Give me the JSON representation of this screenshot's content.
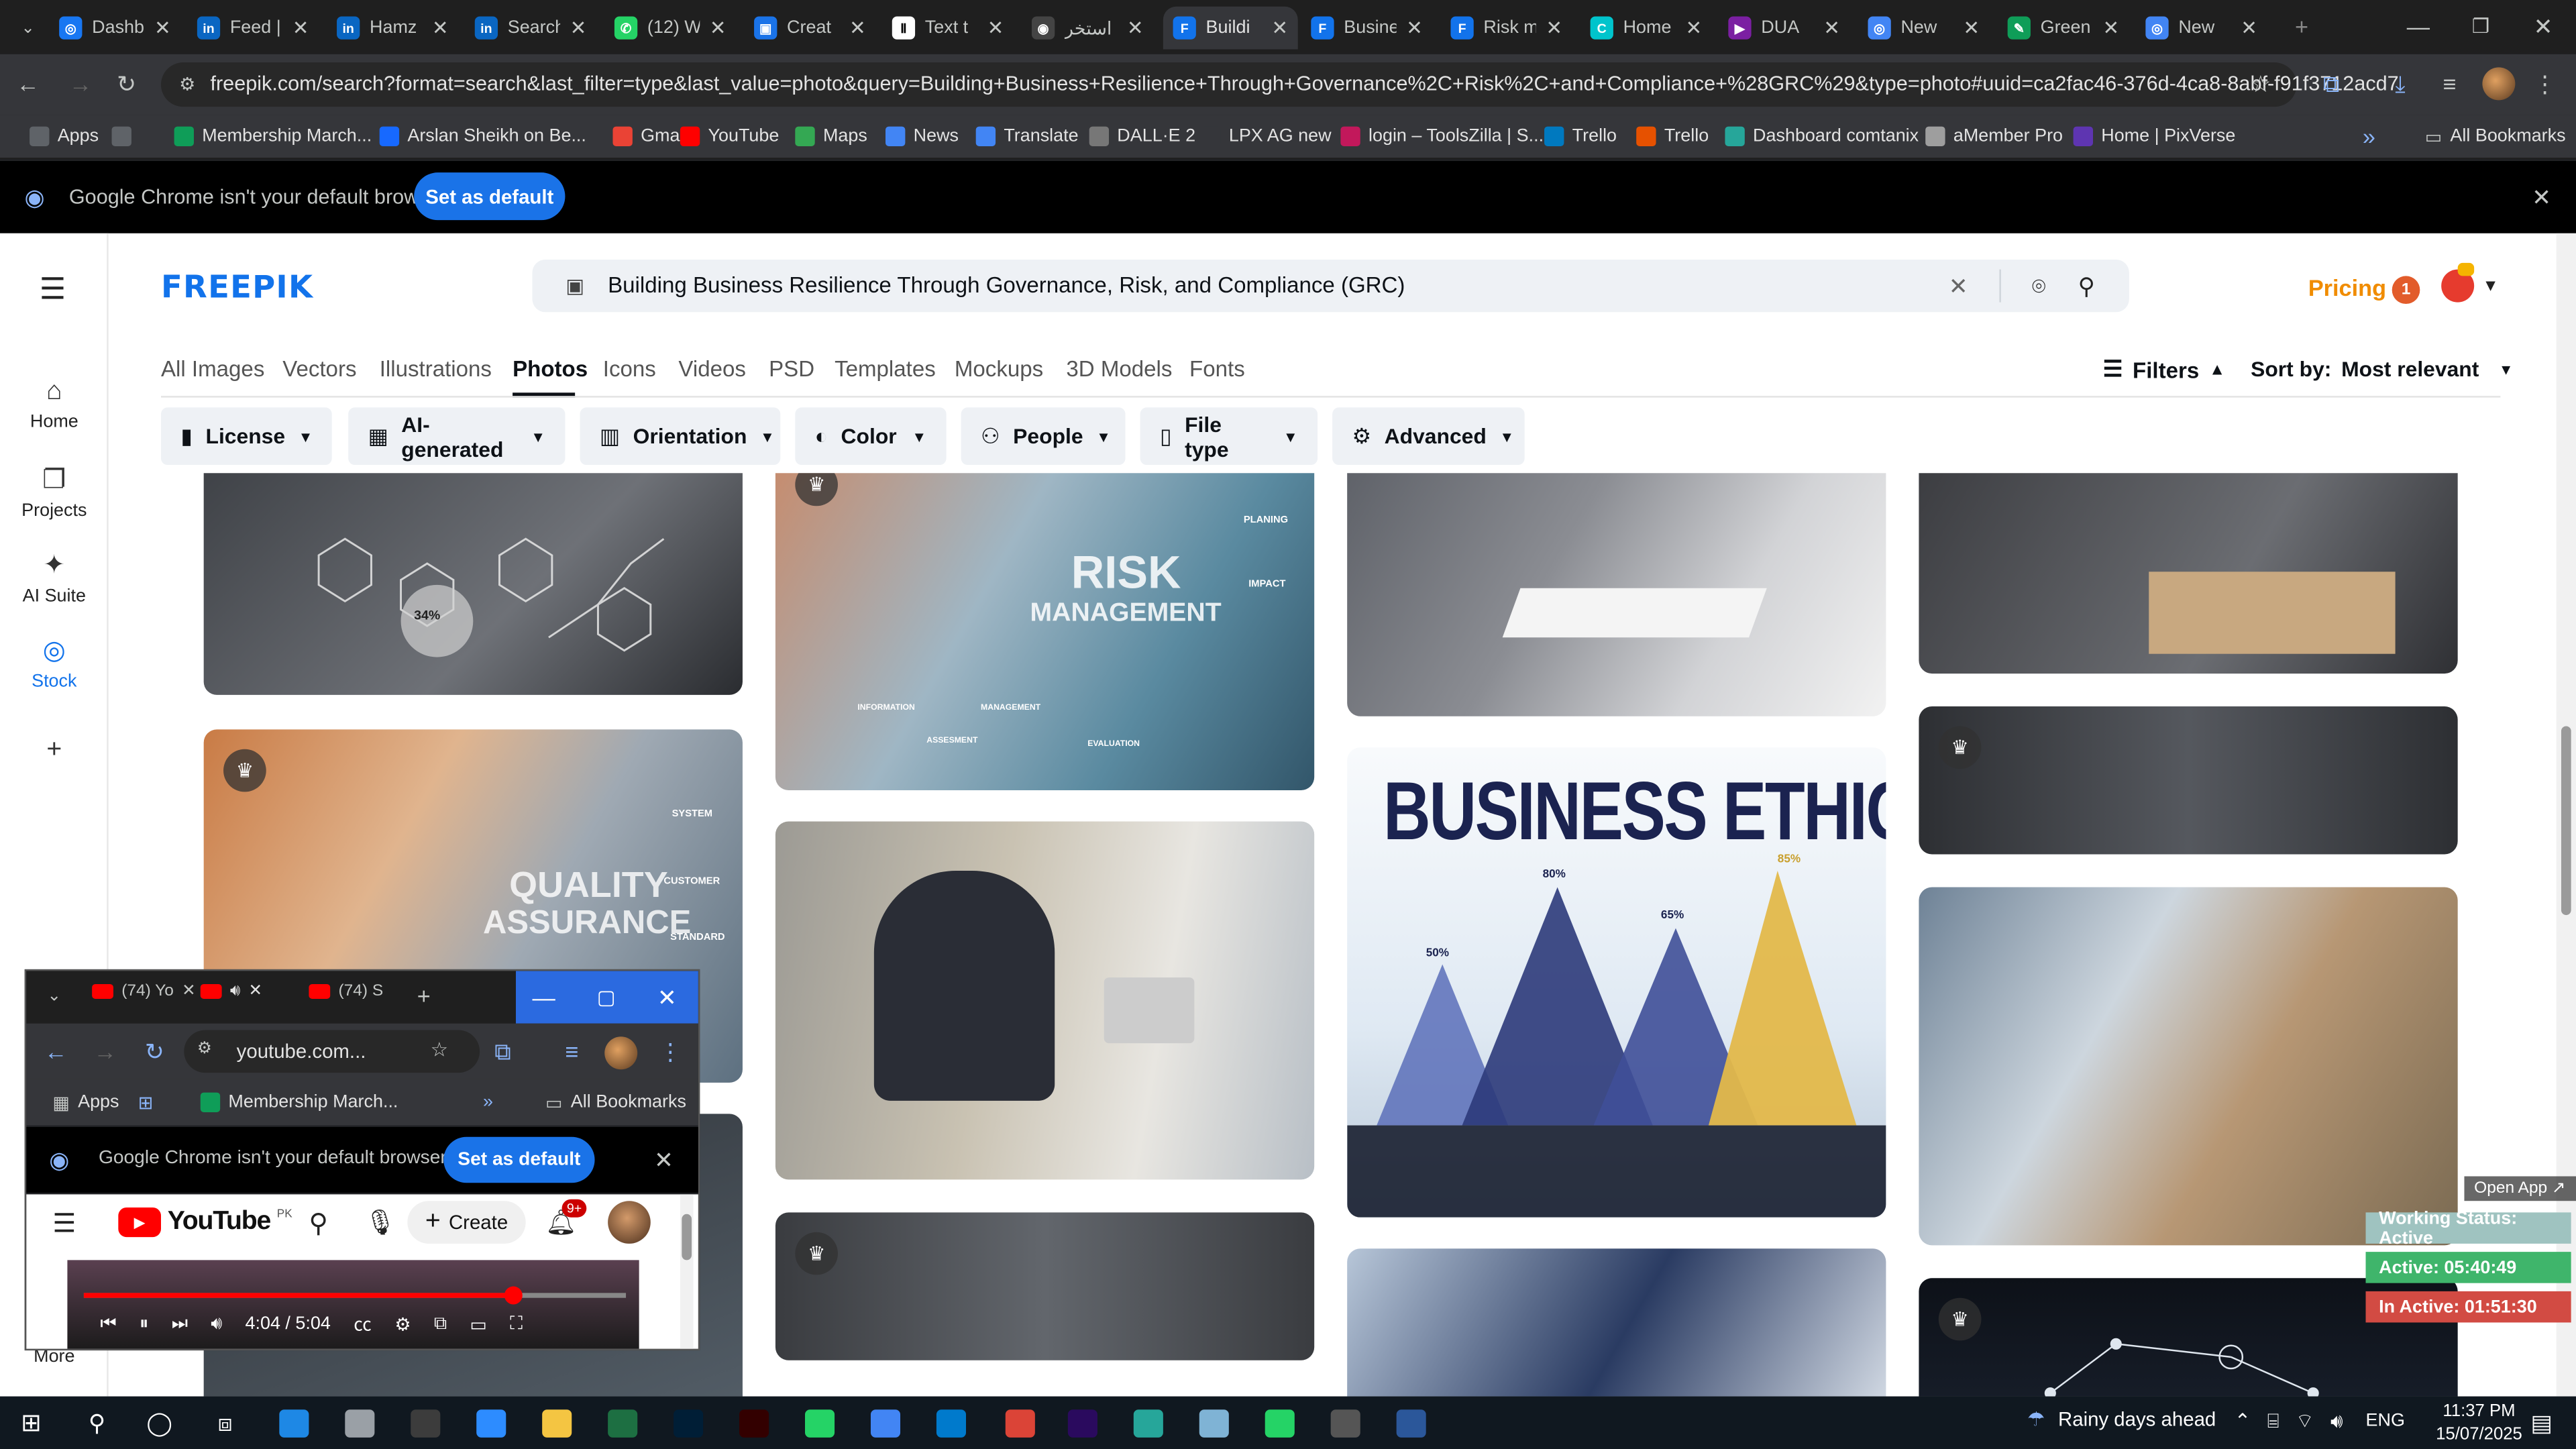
{
  "browser": {
    "tabs": [
      {
        "label": "Dashb",
        "fav_color": "#1877f2",
        "fav_text": "◎"
      },
      {
        "label": "Feed |",
        "fav_color": "#0a66c2",
        "fav_text": "in"
      },
      {
        "label": "Hamz",
        "fav_color": "#0a66c2",
        "fav_text": "in"
      },
      {
        "label": "Search",
        "fav_color": "#0a66c2",
        "fav_text": "in"
      },
      {
        "label": "(12) W",
        "fav_color": "#25d366",
        "fav_text": "✆"
      },
      {
        "label": "Creat",
        "fav_color": "#1a73e8",
        "fav_text": "▣"
      },
      {
        "label": "Text t",
        "fav_color": "#ffffff",
        "fav_text": "Ⅱ"
      },
      {
        "label": "استخر",
        "fav_color": "#444444",
        "fav_text": "◉"
      },
      {
        "label": "Buildi",
        "fav_color": "#1273eb",
        "fav_text": "F"
      },
      {
        "label": "Busine",
        "fav_color": "#1273eb",
        "fav_text": "F"
      },
      {
        "label": "Risk m",
        "fav_color": "#1273eb",
        "fav_text": "F"
      },
      {
        "label": "Home",
        "fav_color": "#00c4cc",
        "fav_text": "C"
      },
      {
        "label": "DUA",
        "fav_color": "#7b1fa2",
        "fav_text": "▶"
      },
      {
        "label": "New",
        "fav_color": "#4285f4",
        "fav_text": "◎"
      },
      {
        "label": "Green",
        "fav_color": "#0f9d58",
        "fav_text": "✎"
      },
      {
        "label": "New",
        "fav_color": "#4285f4",
        "fav_text": "◎"
      }
    ],
    "active_tab_index": 8,
    "url": "freepik.com/search?format=search&last_filter=type&last_value=photo&query=Building+Business+Resilience+Through+Governance%2C+Risk%2C+and+Compliance+%28GRC%29&type=photo#uuid=ca2fac46-376d-4ca8-8abf-f91f3712acd7",
    "bookmarks": [
      {
        "label": "Apps",
        "color": "#5f6368"
      },
      {
        "label": "",
        "color": "#5f6368"
      },
      {
        "label": "Membership March...",
        "color": "#0f9d58"
      },
      {
        "label": "Arslan Sheikh on Be...",
        "color": "#1769ff"
      },
      {
        "label": "Gmail",
        "color": "#ea4335"
      },
      {
        "label": "YouTube",
        "color": "#ff0000"
      },
      {
        "label": "Maps",
        "color": "#34a853"
      },
      {
        "label": "News",
        "color": "#4285f4"
      },
      {
        "label": "Translate",
        "color": "#4285f4"
      },
      {
        "label": "DALL·E 2",
        "color": "#777777"
      },
      {
        "label": "LPX AG new",
        "color": "#35363a"
      },
      {
        "label": "login – ToolsZilla | S...",
        "color": "#c2185b"
      },
      {
        "label": "Trello",
        "color": "#0079bf"
      },
      {
        "label": "Trello",
        "color": "#e65100"
      },
      {
        "label": "Dashboard comtanix",
        "color": "#26a69a"
      },
      {
        "label": "aMember Pro",
        "color": "#9e9e9e"
      },
      {
        "label": "Home | PixVerse",
        "color": "#5e35b1"
      }
    ],
    "all_bookmarks": "All Bookmarks",
    "infobar_text": "Google Chrome isn't your default browser",
    "set_default": "Set as default"
  },
  "freepik": {
    "logo": "FREEPIK",
    "search_query": "Building Business Resilience Through Governance, Risk, and Compliance (GRC)",
    "pricing": "Pricing",
    "notif_count": "1",
    "nav": [
      {
        "label": "Home",
        "icon": "⌂"
      },
      {
        "label": "Projects",
        "icon": "❐"
      },
      {
        "label": "AI Suite",
        "icon": "✦"
      },
      {
        "label": "Stock",
        "icon": "◎"
      },
      {
        "label": "",
        "icon": "+"
      }
    ],
    "more": "More",
    "categories": [
      "All Images",
      "Vectors",
      "Illustrations",
      "Photos",
      "Icons",
      "Videos",
      "PSD",
      "Templates",
      "Mockups",
      "3D Models",
      "Fonts"
    ],
    "active_category": "Photos",
    "filters_label": "Filters",
    "sort_label": "Sort by:",
    "sort_value": "Most relevant",
    "chips": [
      {
        "label": "License",
        "icon": "▮"
      },
      {
        "label": "AI-generated",
        "icon": "▦"
      },
      {
        "label": "Orientation",
        "icon": "▥"
      },
      {
        "label": "Color",
        "icon": "◐"
      },
      {
        "label": "People",
        "icon": "⚇"
      },
      {
        "label": "File type",
        "icon": "▯"
      },
      {
        "label": "Advanced",
        "icon": "⚙"
      }
    ],
    "image_text": {
      "risk_title": "RISK",
      "risk_sub": "MANAGEMENT",
      "risk_tags": [
        "PLANING",
        "IMPACT",
        "INFORMATION",
        "ASSESMENT",
        "MANAGEMENT",
        "EVALUATION"
      ],
      "quality_title": "QUALITY",
      "quality_sub": "ASSURANCE",
      "quality_tags": [
        "SYSTEM",
        "CUSTOMER",
        "STANDARD"
      ],
      "ethics_title": "BUSINESS ETHICS",
      "ethics_pcts": [
        "50%",
        "80%",
        "65%",
        "85%"
      ],
      "pie_label": "34%"
    }
  },
  "youtube_window": {
    "tabs": [
      "(74) Yo",
      "",
      "(74) S"
    ],
    "url": "youtube.com...",
    "bookmarks": [
      "Apps",
      "Membership March..."
    ],
    "all_bookmarks": "All Bookmarks",
    "infobar_text": "Google Chrome isn't your default browser",
    "set_default": "Set as default",
    "logo": "YouTube",
    "country": "PK",
    "create": "Create",
    "notif_badge": "9+",
    "time": "4:04 / 5:04",
    "progress": 0.79
  },
  "tracker": {
    "open_app": "Open App ↗",
    "status": "Working Status: Active",
    "active": "Active: 05:40:49",
    "inactive": "In Active: 01:51:30"
  },
  "taskbar": {
    "weather": "Rainy days ahead",
    "lang": "ENG",
    "time": "11:37 PM",
    "date": "15/07/2025"
  }
}
